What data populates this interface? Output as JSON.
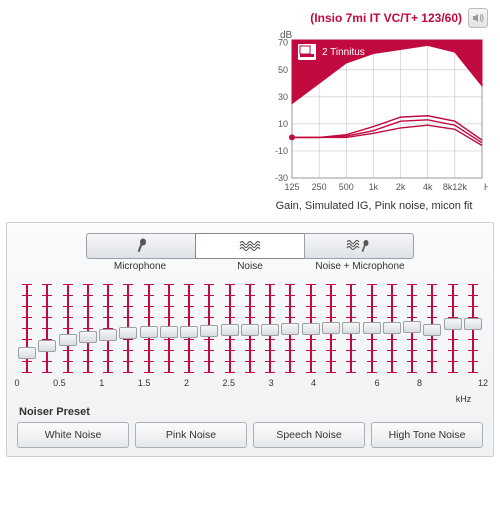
{
  "device": {
    "name": "(Insio 7mi IT VC/T+ 123/60)"
  },
  "chart_data": {
    "type": "line",
    "title": "",
    "badge": "2 Tinnitus",
    "xlabel": "Hz",
    "ylabel": "dB",
    "x_ticks": [
      "125",
      "250",
      "500",
      "1k",
      "2k",
      "4k",
      "8k12k"
    ],
    "y_ticks": [
      -30,
      -10,
      10,
      30,
      50,
      70
    ],
    "ylim": [
      -30,
      72
    ],
    "x_index": [
      0,
      1,
      2,
      3,
      4,
      5,
      6,
      7
    ],
    "series": [
      {
        "name": "fill-upper",
        "values": [
          25,
          40,
          55,
          62,
          65,
          68,
          63,
          38
        ],
        "fill": true
      },
      {
        "name": "curve-a",
        "values": [
          0,
          0,
          2,
          8,
          15,
          16,
          12,
          -2
        ]
      },
      {
        "name": "curve-b",
        "values": [
          0,
          0,
          1,
          5,
          12,
          13,
          9,
          -4
        ]
      },
      {
        "name": "curve-c",
        "values": [
          0,
          0,
          0,
          3,
          7,
          9,
          6,
          -6
        ]
      }
    ],
    "caption": "Gain, Simulated IG, Pink noise, micon fit"
  },
  "modes": {
    "items": [
      {
        "label": "Microphone",
        "icon": "microphone-icon"
      },
      {
        "label": "Noise",
        "icon": "noise-icon"
      },
      {
        "label": "Noise + Microphone",
        "icon": "noise-mic-icon"
      }
    ],
    "active_index": 1
  },
  "equalizer": {
    "unit": "kHz",
    "ticks": [
      "0",
      "0.5",
      "1",
      "1.5",
      "2",
      "2.5",
      "3",
      "4",
      "6",
      "8",
      "12"
    ],
    "sliders_pct": [
      22,
      30,
      36,
      40,
      42,
      44,
      45,
      45,
      46,
      47,
      48,
      48,
      48,
      49,
      49,
      50,
      50,
      50,
      50,
      51,
      48,
      54,
      55
    ]
  },
  "presets": {
    "label": "Noiser Preset",
    "items": [
      "White Noise",
      "Pink Noise",
      "Speech Noise",
      "High Tone Noise"
    ]
  },
  "colors": {
    "accent": "#c10a3f"
  }
}
